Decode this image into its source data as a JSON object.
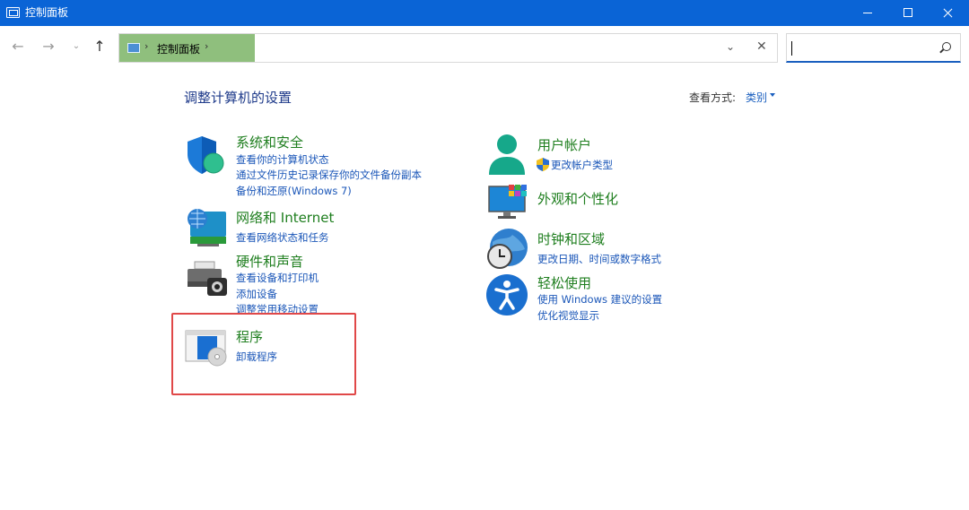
{
  "window": {
    "title": "控制面板"
  },
  "nav": {
    "back": "←",
    "forward": "→",
    "recent": "⌄",
    "up": "↑",
    "breadcrumb_sep": "›",
    "breadcrumb": "控制面板",
    "breadcrumb_trailing_sep": "›",
    "address_dropdown": "⌄",
    "address_clear": "✕"
  },
  "search": {
    "value": "",
    "placeholder": ""
  },
  "main": {
    "title": "调整计算机的设置",
    "view_by_label": "查看方式:",
    "view_by_value": "类别"
  },
  "categories_left": [
    {
      "title": "系统和安全",
      "icon": "shield-icon",
      "links": [
        "查看你的计算机状态",
        "通过文件历史记录保存你的文件备份副本",
        "备份和还原(Windows 7)"
      ]
    },
    {
      "title": "网络和 Internet",
      "icon": "network-globe-icon",
      "links": [
        "查看网络状态和任务"
      ]
    },
    {
      "title": "硬件和声音",
      "icon": "printer-camera-icon",
      "links": [
        "查看设备和打印机",
        "添加设备",
        "调整常用移动设置"
      ]
    },
    {
      "title": "程序",
      "icon": "programs-disc-icon",
      "links": [
        "卸载程序"
      ]
    }
  ],
  "categories_right": [
    {
      "title": "用户帐户",
      "icon": "user-icon",
      "links": [
        "更改帐户类型"
      ]
    },
    {
      "title": "外观和个性化",
      "icon": "monitor-personalize-icon",
      "links": []
    },
    {
      "title": "时钟和区域",
      "icon": "clock-globe-icon",
      "links": [
        "更改日期、时间或数字格式"
      ]
    },
    {
      "title": "轻松使用",
      "icon": "accessibility-icon",
      "links": [
        "使用 Windows 建议的设置",
        "优化视觉显示"
      ]
    }
  ],
  "colors": {
    "titlebar": "#0a64d6",
    "category_title": "#1e7e1e",
    "link": "#1a56b8",
    "highlight": "#e04848",
    "breadcrumb_bg": "#8fbf7d"
  }
}
